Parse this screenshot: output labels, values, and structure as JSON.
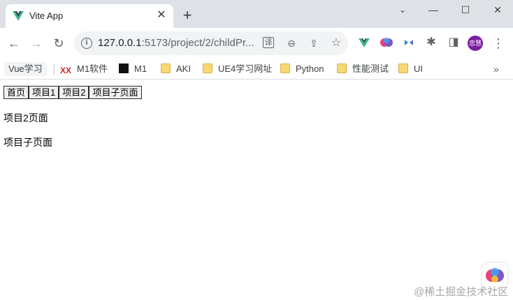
{
  "browser": {
    "tab": {
      "title": "Vite App",
      "close": "✕"
    },
    "new_tab": "+",
    "window": {
      "minimize": "—",
      "maximize": "☐",
      "close": "✕"
    },
    "nav": {
      "back": "←",
      "forward": "→",
      "reload": "↻"
    },
    "address": {
      "host": "127.0.0.1",
      "port_path": ":5173/project/2/childPr..."
    },
    "omnibox_icons": {
      "translate": "译",
      "zoom": "⊖",
      "share": "⇪",
      "star": "☆"
    },
    "extensions": {
      "puzzle": "✱",
      "sidepanel": "◨"
    },
    "avatar_text": "忠慧",
    "menu": "⋮",
    "bookmarks": [
      {
        "label": "Vue学习"
      },
      {
        "label": "M1软件",
        "icon": "xx"
      },
      {
        "label": "M1",
        "icon": "m1"
      },
      {
        "label": "AKI",
        "icon": "folder"
      },
      {
        "label": "UE4学习网址",
        "icon": "folder"
      },
      {
        "label": "Python",
        "icon": "folder"
      },
      {
        "label": "性能测试",
        "icon": "folder"
      },
      {
        "label": "UI",
        "icon": "folder"
      }
    ],
    "bookmarks_more": "»",
    "colors": {
      "tabstrip": "#dee1e6",
      "omnibox": "#f1f3f4",
      "vue_green": "#42b883",
      "avatar": "#7b1fa2"
    }
  },
  "page": {
    "nav_buttons": [
      "首页",
      "项目1",
      "项目2",
      "项目子页面"
    ],
    "project_text": "项目2页面",
    "child_text": "项目子页面"
  },
  "watermark": "@稀土掘金技术社区"
}
